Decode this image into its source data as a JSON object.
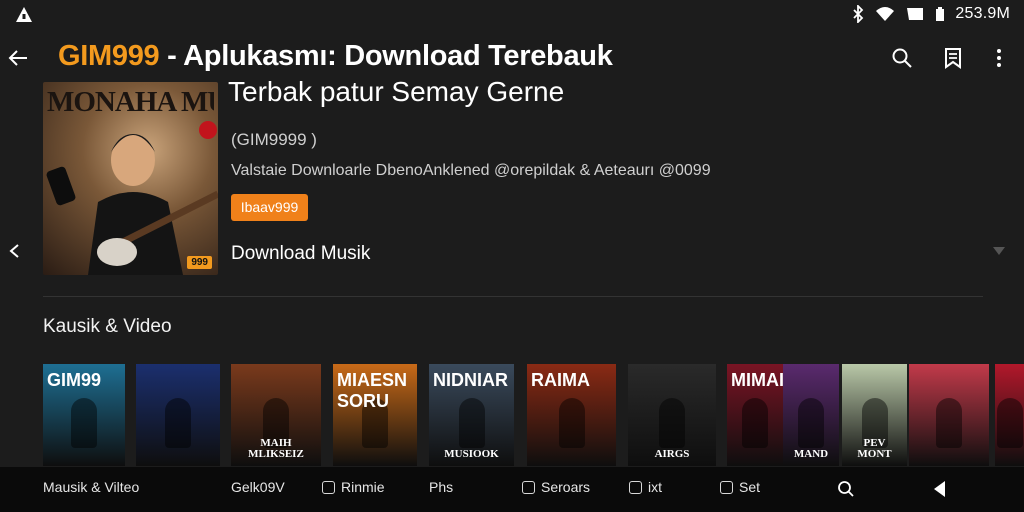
{
  "status_bar": {
    "time": "253.9M",
    "icons": [
      "bluetooth-icon",
      "wifi-icon",
      "signal-icon",
      "battery-icon"
    ]
  },
  "header": {
    "brand": "GIM999",
    "title_rest": " - Aplukasmı: Download Terebauk",
    "title_line2": "Terbak patur Semay Gerne"
  },
  "poster": {
    "title": "MONAHA MUISE",
    "badge": "999"
  },
  "details": {
    "handle": "(GIM9999 )",
    "description": "Valstaie Downloarle DbenoAnklened @orepildak & Aeteaurı @0099",
    "tag_button": "Ibaav999",
    "download_label": "Download Musik"
  },
  "section": {
    "title": "Kausik & Video"
  },
  "cards": [
    {
      "title": "GIM99",
      "caption": "",
      "bg": "#1e6f93"
    },
    {
      "title": "",
      "caption": "",
      "bg": "#1b2f6e"
    },
    {
      "title": "",
      "caption": "MAIH MLIKSEIZ",
      "bg": "#7a3a1c"
    },
    {
      "title": "MIAESN SORU",
      "caption": "",
      "bg": "#c86a18"
    },
    {
      "title": "NIDNIAR",
      "caption": "MUSIOOK",
      "bg": "#3a4a5c"
    },
    {
      "title": "RAIMA",
      "caption": "",
      "bg": "#8a2a14"
    },
    {
      "title": "",
      "caption": "AIRGS",
      "bg": "#2a2a2a"
    },
    {
      "title": "MIMAI",
      "caption": "",
      "bg": "#7a1424"
    },
    {
      "title": "",
      "caption": "MAND",
      "bg": "#5a2a6e"
    },
    {
      "title": "",
      "caption": "PEV MONT",
      "bg": "#b9c8a8"
    },
    {
      "title": "",
      "caption": "",
      "bg": "#c23a4a"
    },
    {
      "title": "",
      "caption": "",
      "bg": "#b2182b"
    }
  ],
  "bottom_nav": {
    "items": [
      {
        "label": "Mausik & Vilteo",
        "icon": ""
      },
      {
        "label": "Gelk09V",
        "icon": ""
      },
      {
        "label": "Rinmie",
        "icon": "box"
      },
      {
        "label": "Phs",
        "icon": ""
      },
      {
        "label": "Seroars",
        "icon": "box"
      },
      {
        "label": "ixt",
        "icon": "box-dot"
      },
      {
        "label": "Set",
        "icon": "box"
      }
    ]
  },
  "colors": {
    "accent": "#f39a1e",
    "tag_button": "#f0811a",
    "background": "#1c1c1c",
    "bottom_nav": "#0a0a0a"
  }
}
